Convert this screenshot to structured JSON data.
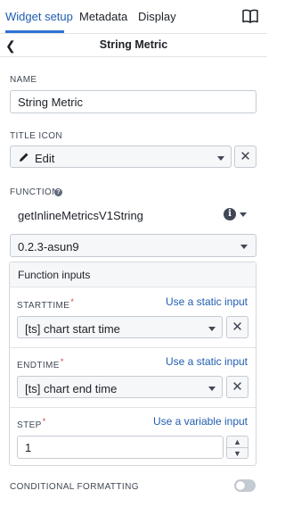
{
  "tabs": [
    {
      "label": "Widget setup"
    },
    {
      "label": "Metadata"
    },
    {
      "label": "Display"
    }
  ],
  "header": {
    "title": "String Metric"
  },
  "name": {
    "label": "NAME",
    "value": "String Metric"
  },
  "title_icon": {
    "label": "TITLE ICON",
    "value": "Edit"
  },
  "function": {
    "label": "FUNCTION",
    "value": "getInlineMetricsV1String",
    "version": "0.2.3-asun9"
  },
  "function_inputs": {
    "title": "Function inputs",
    "starttime": {
      "label": "STARTTIME",
      "link": "Use a static input",
      "value": "[ts] chart start time"
    },
    "endtime": {
      "label": "ENDTIME",
      "link": "Use a static input",
      "value": "[ts] chart end time"
    },
    "step": {
      "label": "STEP",
      "link": "Use a variable input",
      "value": "1"
    }
  },
  "conditional_formatting": {
    "label": "CONDITIONAL FORMATTING",
    "enabled": false
  },
  "colors": {
    "accent": "#2d72d2",
    "link": "#215db0",
    "required": "#cd4246"
  }
}
